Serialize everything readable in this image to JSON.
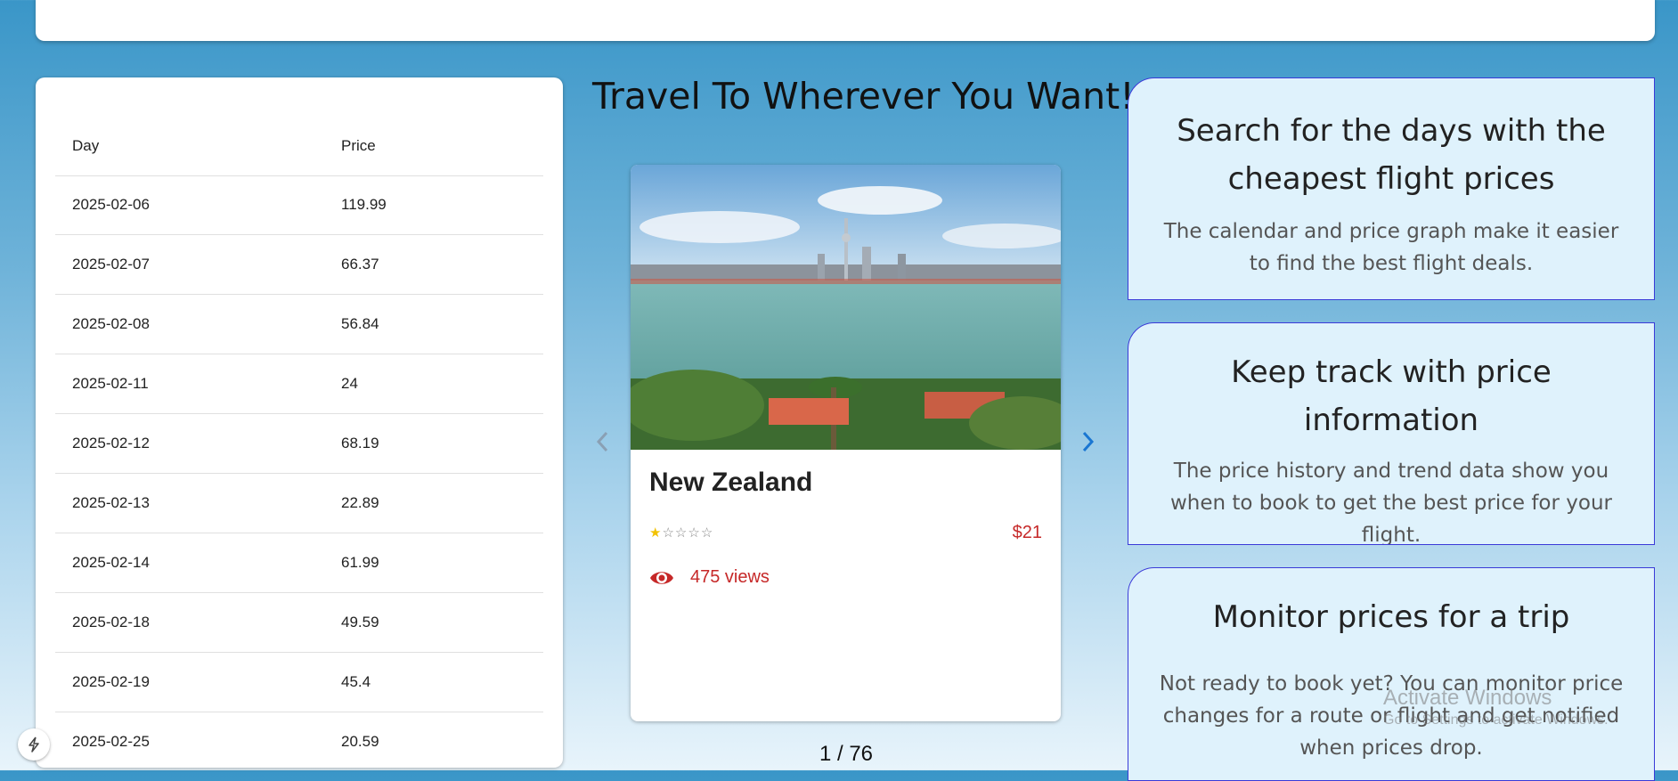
{
  "table": {
    "headers": {
      "day": "Day",
      "price": "Price"
    },
    "rows": [
      {
        "day": "2025-02-06",
        "price": "119.99"
      },
      {
        "day": "2025-02-07",
        "price": "66.37"
      },
      {
        "day": "2025-02-08",
        "price": "56.84"
      },
      {
        "day": "2025-02-11",
        "price": "24"
      },
      {
        "day": "2025-02-12",
        "price": "68.19"
      },
      {
        "day": "2025-02-13",
        "price": "22.89"
      },
      {
        "day": "2025-02-14",
        "price": "61.99"
      },
      {
        "day": "2025-02-18",
        "price": "49.59"
      },
      {
        "day": "2025-02-19",
        "price": "45.4"
      },
      {
        "day": "2025-02-25",
        "price": "20.59"
      }
    ]
  },
  "headline": "Travel To Wherever You Want!",
  "carousel": {
    "destination": "New Zealand",
    "rating": 1,
    "rating_max": 5,
    "price": "$21",
    "views": "475 views",
    "pager": "1 / 76",
    "prev_icon": "chevron-left-icon",
    "next_icon": "chevron-right-icon"
  },
  "features": [
    {
      "title": "Search for the days with the cheapest flight prices",
      "desc": "The calendar and price graph make it easier to find the best flight deals."
    },
    {
      "title": "Keep track with price information",
      "desc": "The price history and trend data show you when to book to get the best price for your flight."
    },
    {
      "title": "Monitor prices for a trip",
      "desc": "Not ready to book yet? You can monitor price changes for a route or flight and get notified when prices drop."
    }
  ],
  "watermark": {
    "line1": "Activate Windows",
    "line2": "Go to Settings to activate Windows."
  },
  "colors": {
    "accent_red": "#c62828",
    "feature_bg": "#dff2fc",
    "feature_border": "#3a3ad8",
    "arrow_blue": "#1976d2"
  }
}
